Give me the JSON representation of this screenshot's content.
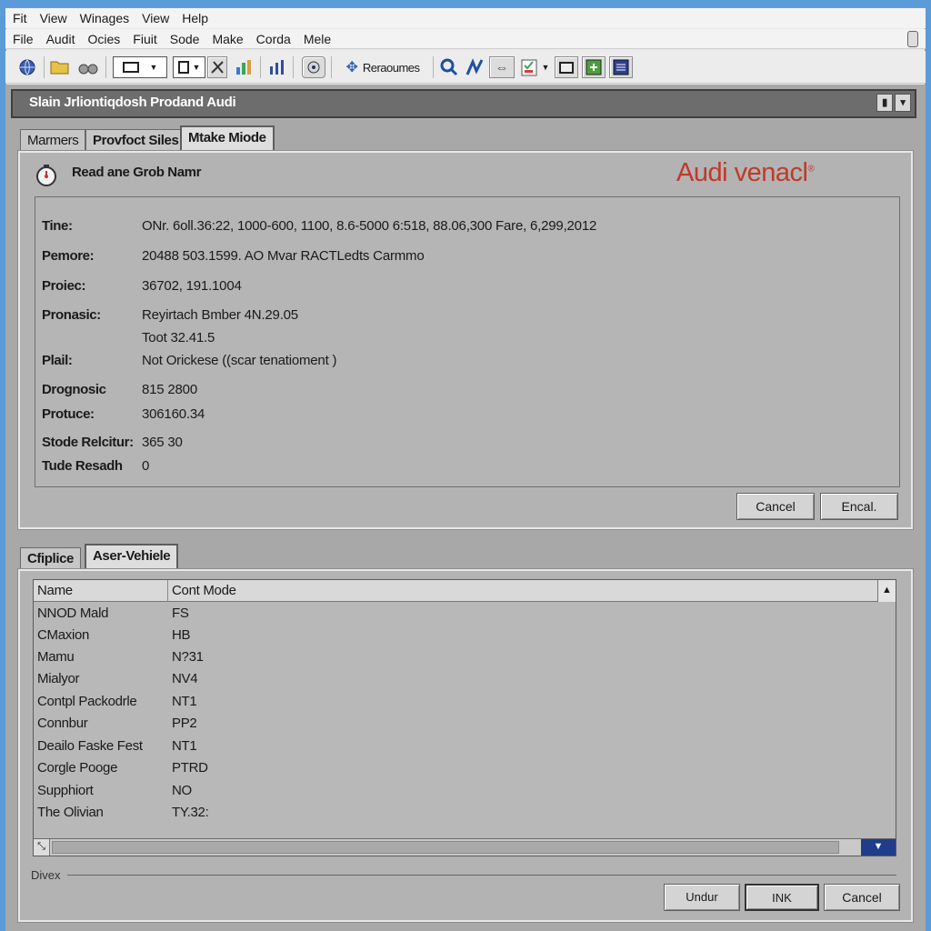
{
  "menu_row1": [
    "Fit",
    "View",
    "Winages",
    "View",
    "Help"
  ],
  "menu_row2": [
    "File",
    "Audit",
    "Ocies",
    "Fiuit",
    "Sode",
    "Make",
    "Corda",
    "Mele"
  ],
  "toolbar": {
    "rearrange_label": "Reraoumes"
  },
  "header": {
    "title": "Slain Jrliontiqdosh Prodand Audi"
  },
  "top_tabs": [
    "Marmers",
    "Provfoct Siles",
    "Mtake Miode"
  ],
  "details": {
    "heading": "Read ane Grob Namr",
    "brand": "Audi venacl",
    "brand_mark": "®",
    "fields": [
      {
        "label": "Tine:",
        "value": "ONr. 6oll.36:22, 1000-600, 1100, 8.6-5000 6:518, 88.06,300 Fare, 6,299,2012"
      },
      {
        "label": "Pemore:",
        "value": "20488 503.1599. AO Mvar RACTLedts Carmmo"
      },
      {
        "label": "Proiec:",
        "value": "36702, 191.1004"
      },
      {
        "label": "Pronasic:",
        "value": "Reyirtach Bmber 4N.29.05"
      },
      {
        "label": "",
        "value": "Toot 32.41.5"
      },
      {
        "label": "Plail:",
        "value": "Not Orickese ((scar tenatioment )"
      },
      {
        "label": "Drognosic",
        "value": "815 2800"
      },
      {
        "label": "Protuce:",
        "value": "306160.34"
      },
      {
        "label": "Stode Relcitur:",
        "value": "365 30"
      },
      {
        "label": "Tude Resadh",
        "value": "0"
      }
    ],
    "cancel_label": "Cancel",
    "encal_label": "Encal."
  },
  "bottom_tabs": [
    "Cfiplice",
    "Aser-Vehiele"
  ],
  "vehicle_table": {
    "columns": [
      "Name",
      "Cont Mode"
    ],
    "rows": [
      {
        "name": "NNOD Mald",
        "mode": "FS"
      },
      {
        "name": "CMaxion",
        "mode": "HB"
      },
      {
        "name": "Mamu",
        "mode": "N?31"
      },
      {
        "name": "Mialyor",
        "mode": "NV4"
      },
      {
        "name": "Contpl Packodrle",
        "mode": "NT1"
      },
      {
        "name": "Connbur",
        "mode": "PP2"
      },
      {
        "name": "Deailo Faske Fest",
        "mode": "NT1"
      },
      {
        "name": "Corgle Pooge",
        "mode": "PTRD"
      },
      {
        "name": "Supphiort",
        "mode": "NO"
      },
      {
        "name": "The Olivian",
        "mode": "TY.32:"
      }
    ]
  },
  "footer": {
    "group_label": "Divex",
    "undo_label": "Undur",
    "ok_label": "INK",
    "cancel_label": "Cancel"
  },
  "colors": {
    "brand": "#c0392b",
    "titlebar": "#6d6d6d",
    "desktop": "#5b9bd8",
    "scroll_accent": "#1f3d8c"
  }
}
